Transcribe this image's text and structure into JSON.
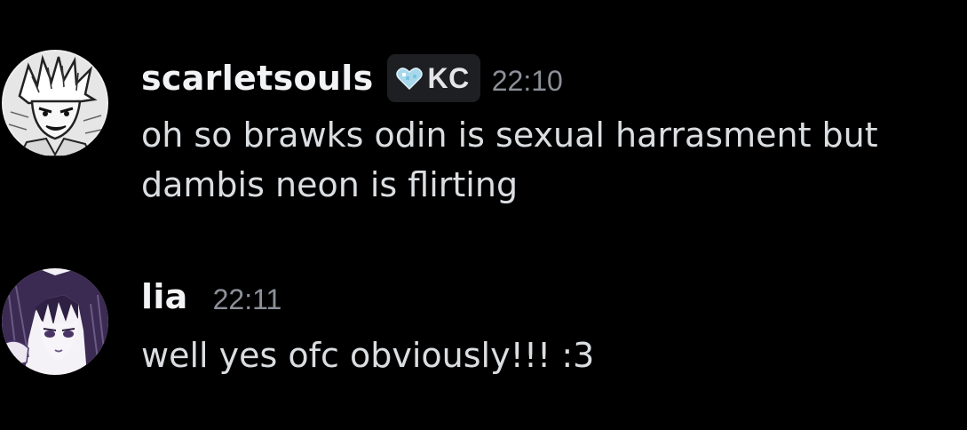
{
  "messages": [
    {
      "author": "scarletsouls",
      "tag": {
        "icon": "heart-icon",
        "label": "KC"
      },
      "timestamp": "22:10",
      "text": "oh so brawks odin is sexual harrasment but\ndambis neon is flirting"
    },
    {
      "author": "lia",
      "timestamp": "22:11",
      "text": "well yes ofc obviously!!! :3"
    }
  ],
  "colors": {
    "background": "#000000",
    "username": "#f2f3f5",
    "message_text": "#dbdee1",
    "timestamp": "#8d9099",
    "tag_background": "#1e1f22",
    "heart_icon": "#a8d8ec"
  }
}
